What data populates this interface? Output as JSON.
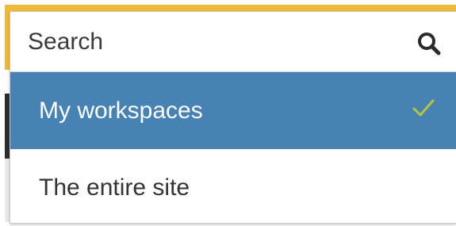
{
  "search": {
    "placeholder": "Search",
    "icon": "search-icon"
  },
  "scope_options": [
    {
      "label": "My workspaces",
      "selected": true,
      "check_icon": "checkmark-icon"
    },
    {
      "label": "The entire site",
      "selected": false
    }
  ],
  "colors": {
    "accent": "#f2b935",
    "selected_background": "#4682b4",
    "selected_text": "#ffffff",
    "check": "#b5c934"
  }
}
